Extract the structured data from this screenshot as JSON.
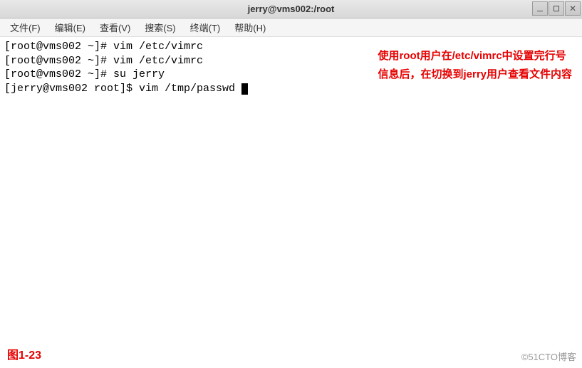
{
  "titlebar": {
    "title": "jerry@vms002:/root"
  },
  "menu": {
    "file": "文件(F)",
    "edit": "编辑(E)",
    "view": "查看(V)",
    "search": "搜索(S)",
    "terminal": "终端(T)",
    "help": "帮助(H)"
  },
  "terminal": {
    "line1": "[root@vms002 ~]# vim /etc/vimrc",
    "line2": "[root@vms002 ~]# vim /etc/vimrc",
    "line3": "[root@vms002 ~]# su jerry",
    "line4": "[jerry@vms002 root]$ vim /tmp/passwd "
  },
  "annotation": {
    "line1": "使用root用户在/etc/vimrc中设置完行号",
    "line2": "信息后，在切换到jerry用户查看文件内容"
  },
  "figure_label": "图1-23",
  "watermark": "©51CTO博客"
}
